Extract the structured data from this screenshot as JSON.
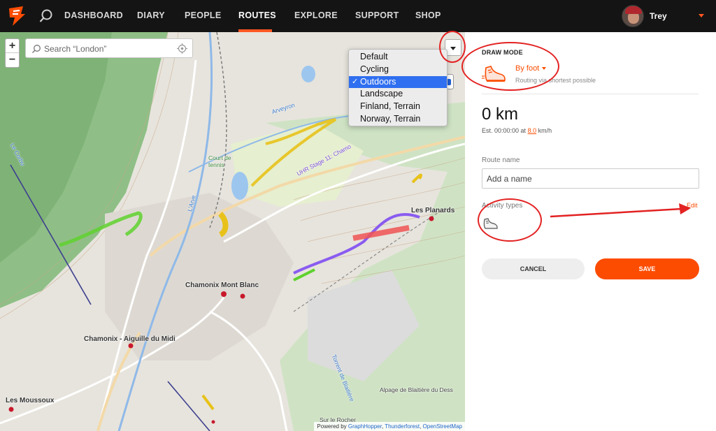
{
  "nav": {
    "items": [
      "DASHBOARD",
      "DIARY",
      "PEOPLE",
      "ROUTES",
      "EXPLORE",
      "SUPPORT",
      "SHOP"
    ],
    "active": "ROUTES",
    "user_name": "Trey",
    "accent_color": "#ff5722"
  },
  "map": {
    "search_placeholder": "Search “London”",
    "zoom_in": "+",
    "zoom_out": "−",
    "layer_options": [
      "Default",
      "Cycling",
      "Outdoors",
      "Landscape",
      "Finland, Terrain",
      "Norway, Terrain"
    ],
    "selected_layer": "Outdoors",
    "places": {
      "chamonix": "Chamonix Mont Blanc",
      "aiguille": "Chamonix - Aiguille du Midi",
      "planards": "Les Planards",
      "moussoux": "Les Moussoux",
      "blaitiere": "Alpage de Blaitière du Dess",
      "rocher": "Sur le Rocher",
      "court": "Court de tennis",
      "arveyron": "Arveyron",
      "arve": "L'Arve",
      "corbu": "Le Corbu",
      "torrent": "Torrent de Blaitière",
      "uhr": "UHR Stage 11: Chamo"
    },
    "attribution_prefix": "Powered by",
    "attribution_links": [
      "GraphHopper",
      "Thunderforest",
      "OpenStreetMap"
    ],
    "route_colors": {
      "green": "#5fd12e",
      "yellow": "#e8c21a",
      "purple": "#8a5cf0",
      "red": "#ef5454"
    }
  },
  "panel": {
    "draw_mode_label": "DRAW MODE",
    "draw_mode_value": "By foot",
    "draw_mode_hint": "Routing via shortest possible",
    "distance": "0 km",
    "est_prefix": "Est. 00:00:00 at",
    "speed": "8.0",
    "speed_unit": "km/h",
    "route_name_label": "Route name",
    "route_name_placeholder": "Add a name",
    "activity_types_label": "Activity types",
    "edit_label": "Edit",
    "cancel_label": "CANCEL",
    "save_label": "SAVE",
    "accent_color": "#fc4c02"
  },
  "icons": {
    "logo": "strava-logo-icon",
    "nav_search": "search-icon",
    "map_search": "search-icon",
    "locate": "crosshair-icon",
    "layer_toggle": "chevron-down-icon",
    "draw_mode": "running-shoe-icon",
    "activity": "running-shoe-icon"
  }
}
